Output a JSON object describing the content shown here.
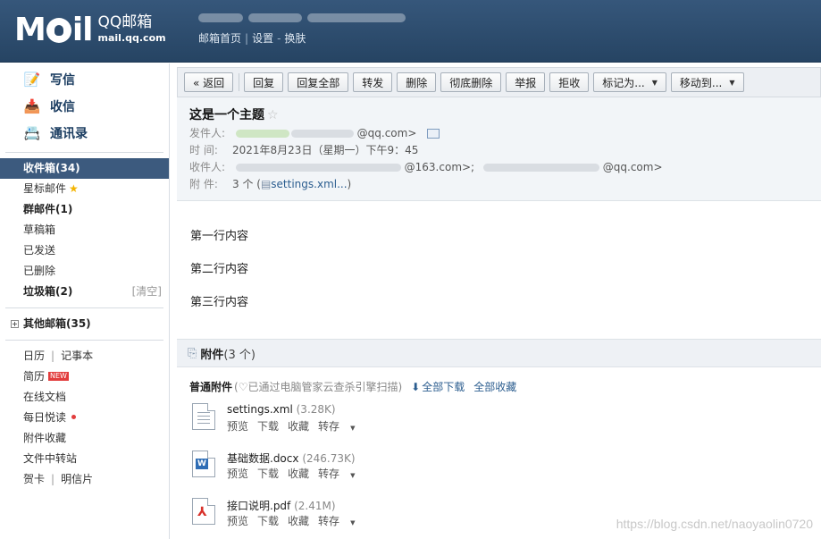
{
  "header": {
    "logo_text": "M",
    "logo_text2": "il",
    "brand_name": "QQ邮箱",
    "brand_domain": "mail.qq.com",
    "links": [
      "邮箱首页",
      "设置",
      "换肤"
    ],
    "link_sep_1": "|",
    "link_sep_2": "-"
  },
  "sidebar": {
    "actions": [
      {
        "label": "写信",
        "icon": "pencil-icon"
      },
      {
        "label": "收信",
        "icon": "inbox-icon"
      },
      {
        "label": "通讯录",
        "icon": "contacts-icon"
      }
    ],
    "inbox": "收件箱(34)",
    "starred": "星标邮件",
    "group": "群邮件(1)",
    "drafts": "草稿箱",
    "sent": "已发送",
    "deleted": "已删除",
    "spam": "垃圾箱(2)",
    "spam_clear": "[清空]",
    "other": "其他邮箱(35)",
    "calendar": "日历",
    "notes": "记事本",
    "resume": "简历",
    "new_badge": "NEW",
    "docs": "在线文档",
    "daily": "每日悦读",
    "attach_fav": "附件收藏",
    "transfer": "文件中转站",
    "card": "贺卡",
    "postcard": "明信片",
    "pipe": "|",
    "plus": "+"
  },
  "toolbar": {
    "back": "« 返回",
    "reply": "回复",
    "reply_all": "回复全部",
    "forward": "转发",
    "delete": "删除",
    "delete_perm": "彻底删除",
    "report": "举报",
    "reject": "拒收",
    "mark_as": "标记为...",
    "move_to": "移动到..."
  },
  "message": {
    "subject": "这是一个主题",
    "from_label": "发件人:",
    "from_suffix": "@qq.com>",
    "time_label": "时   间:",
    "time_value": "2021年8月23日（星期一）下午9：45",
    "to_label": "收件人:",
    "to_suffix_1": "@163.com>;",
    "to_suffix_2": "@qq.com>",
    "att_label": "附   件:",
    "att_value": "3 个 (",
    "att_link": "settings.xml...",
    "att_close": ")",
    "body_lines": [
      "第一行内容",
      "第二行内容",
      "第三行内容"
    ]
  },
  "attachments": {
    "title": "附件",
    "count": "(3 个)",
    "section_label": "普通附件",
    "scan_note": "(♡已通过电脑管家云查杀引擎扫描)",
    "download_all": "全部下载",
    "save_all": "全部收藏",
    "files": [
      {
        "name": "settings.xml",
        "size": "(3.28K)",
        "type": "xml"
      },
      {
        "name": "基础数据.docx",
        "size": "(246.73K)",
        "type": "doc"
      },
      {
        "name": "接口说明.pdf",
        "size": "(2.41M)",
        "type": "pdf"
      }
    ],
    "ops": {
      "preview": "预览",
      "download": "下载",
      "favorite": "收藏",
      "save_to": "转存"
    }
  },
  "watermark": "https://blog.csdn.net/naoyaolin0720"
}
